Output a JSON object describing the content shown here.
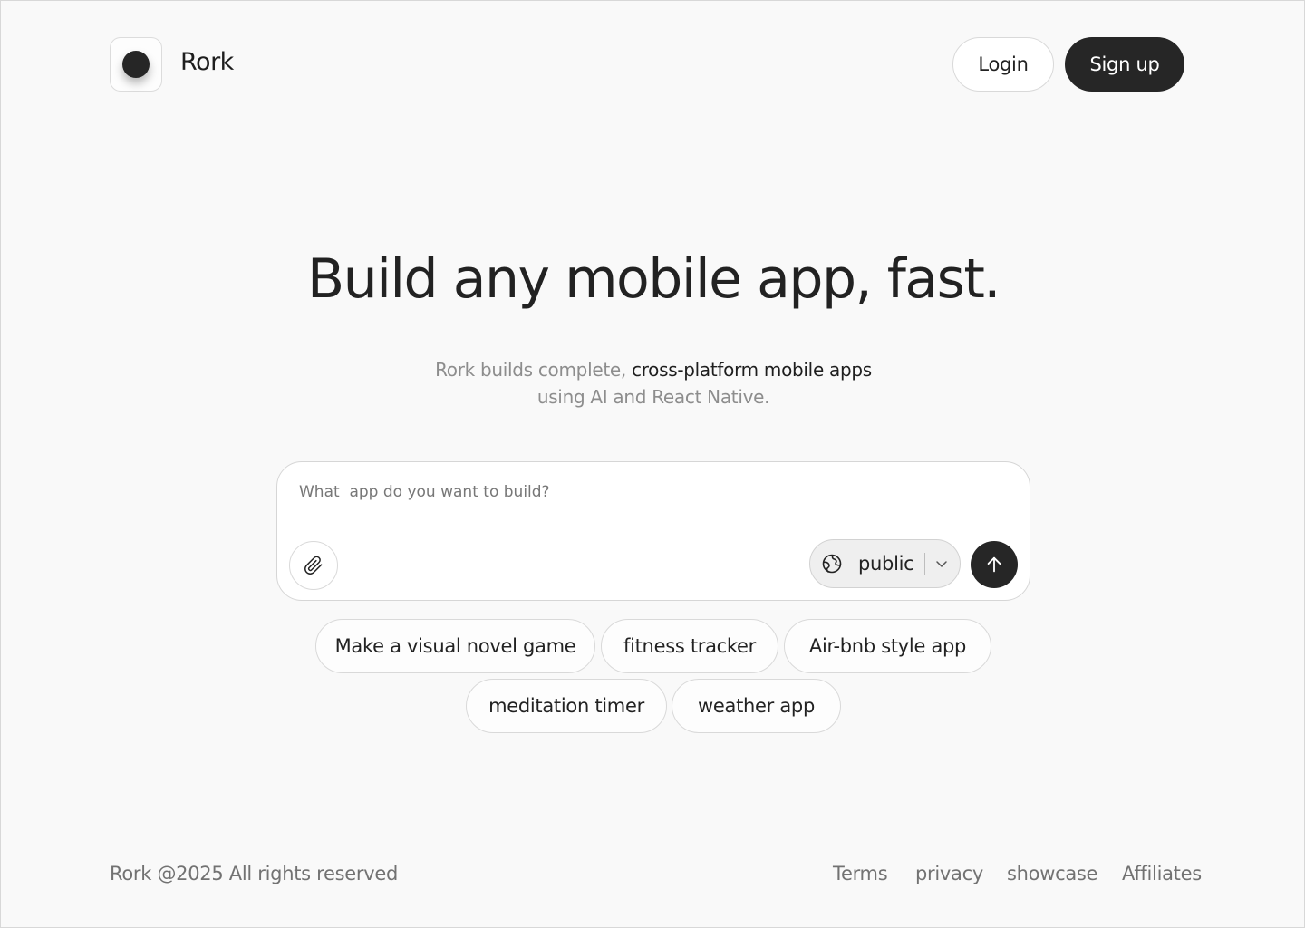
{
  "header": {
    "brand": "Rork",
    "login_label": "Login",
    "signup_label": "Sign up"
  },
  "hero": {
    "title": "Build any mobile app, fast.",
    "subtitle_prefix": "Rork builds complete, ",
    "subtitle_emphasis": "cross-platform mobile apps",
    "subtitle_line2": "using AI and React Native."
  },
  "prompt": {
    "placeholder": "What  app do you want to build?",
    "visibility_value": "public",
    "attach_icon": "paperclip-icon",
    "visibility_icon": "globe-icon",
    "dropdown_icon": "chevron-down-icon",
    "send_icon": "arrow-up-icon"
  },
  "suggestions": [
    "Make a visual novel game",
    "fitness tracker",
    "Air-bnb style app",
    "meditation timer",
    "weather app"
  ],
  "footer": {
    "copyright": "Rork @2025 All rights reserved",
    "links": [
      "Terms",
      "privacy",
      "showcase",
      "Affiliates"
    ]
  },
  "colors": {
    "background": "#f9f9f9",
    "primary_dark": "#262626",
    "muted_text": "#8d8d8d",
    "footer_text": "#727272"
  }
}
